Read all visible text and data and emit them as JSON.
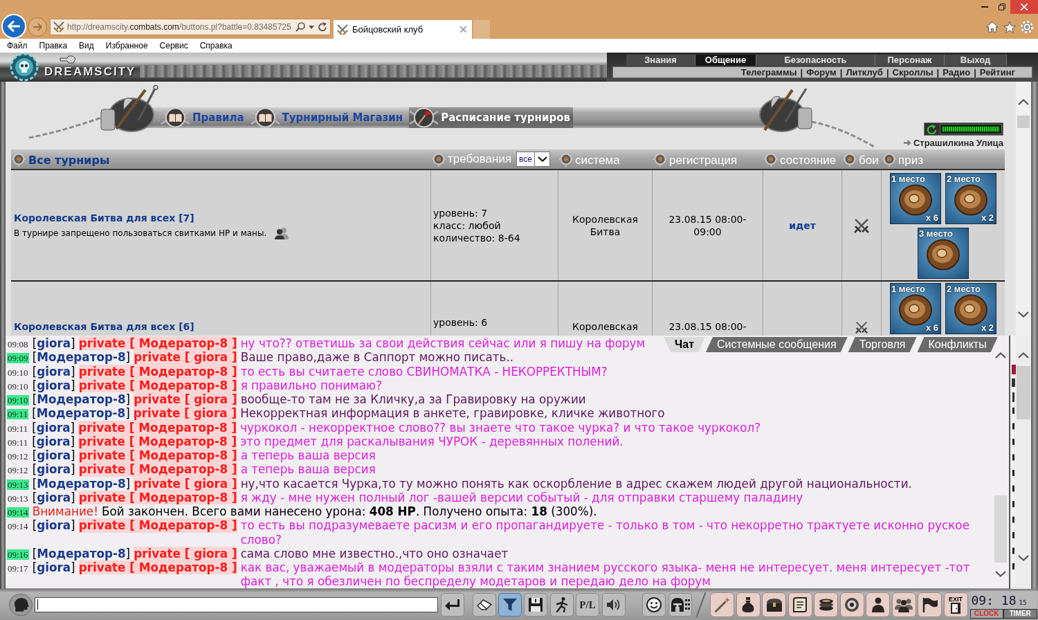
{
  "browser": {
    "address": {
      "start": "http://dreamscity.",
      "domain": "combats.com",
      "end": "/buttons.pl?battle=0.83485725"
    },
    "tabs": [
      {
        "title": "Бойцовский клуб",
        "selected": true
      }
    ],
    "menu": [
      "Файл",
      "Правка",
      "Вид",
      "Избранное",
      "Сервис",
      "Справка"
    ]
  },
  "game_header": {
    "logo": "DREAMSCITY",
    "nav": [
      {
        "label": "Знания",
        "selected": false
      },
      {
        "label": "Общение",
        "selected": true
      },
      {
        "label": "Безопасность",
        "selected": false
      },
      {
        "label": "Персонаж",
        "selected": false
      },
      {
        "label": "Выход",
        "selected": false
      }
    ],
    "subnav": [
      "Телеграммы",
      "Форум",
      "Литклуб",
      "Скроллы",
      "Радио",
      "Рейтинг"
    ],
    "subnav_separator": "|"
  },
  "tournaments": {
    "tabs": [
      {
        "label": "Правила",
        "selected": false
      },
      {
        "label": "Турнирный Магазин",
        "selected": false
      },
      {
        "label": "Расписание турниров",
        "selected": true
      }
    ],
    "refresh_timer": {
      "level": 1
    },
    "location": "Страшилкина Улица",
    "columns": [
      {
        "kind": "link",
        "label": "Все турниры"
      },
      {
        "kind": "filter",
        "label": "требования",
        "filter": "все"
      },
      {
        "kind": "label",
        "label": "система"
      },
      {
        "kind": "label",
        "label": "регистрация"
      },
      {
        "kind": "label",
        "label": "состояние"
      },
      {
        "kind": "label",
        "label": "бои"
      },
      {
        "kind": "label",
        "label": "приз"
      }
    ],
    "rows": [
      {
        "title": "Королевская Битва для всех [7]",
        "note": "В турнире запрещено пользоваться свитками HP и маны.",
        "note_icon": true,
        "requirements": [
          "уровень: 7",
          "класс: любой",
          "количество: 8-64"
        ],
        "system": "Королевская Битва",
        "registration": [
          "23.08.15 08:00-",
          "09:00"
        ],
        "status": "идет",
        "fights": true,
        "prizes": [
          {
            "place": "1 место",
            "count": "x 6"
          },
          {
            "place": "2 место",
            "count": "x 2"
          },
          {
            "place": "3 место"
          }
        ]
      },
      {
        "title": "Королевская Битва для всех [6]",
        "requirements": [
          "уровень: 6"
        ],
        "system": "Королевская",
        "registration": [
          "23.08.15 08:00-"
        ],
        "fights": true,
        "prizes": [
          {
            "place": "1 место",
            "count": "x 6"
          },
          {
            "place": "2 место",
            "count": "x 2"
          }
        ]
      }
    ]
  },
  "chat": {
    "tabs": [
      {
        "label": "Чат",
        "selected": true
      },
      {
        "label": "Системные сообщения",
        "selected": false
      },
      {
        "label": "Торговля",
        "selected": false
      },
      {
        "label": "Конфликты",
        "selected": false
      }
    ],
    "lines": [
      {
        "kind": "private",
        "time": "09:08",
        "highlighted": false,
        "sender": "[**giora**]",
        "private": "private [ Модератор-8 ]",
        "text": "ну что?? ответишь за свои действия сейчас или я пишу на форум",
        "color": "#e01ee0"
      },
      {
        "kind": "private",
        "time": "09:09",
        "highlighted": true,
        "sender": "[**Модератор-8**]",
        "private": "private [ giora ]",
        "text": "Ваше право,даже в Саппорт можно писать..",
        "color": "#5e1760"
      },
      {
        "kind": "private",
        "time": "09:10",
        "highlighted": false,
        "sender": "[**giora**]",
        "private": "private [ Модератор-8 ]",
        "text": "то есть вы считаете слово СВИНОМАТКА - НЕКОРРЕКТНЫМ?",
        "color": "#e01ee0"
      },
      {
        "kind": "private",
        "time": "09:10",
        "highlighted": false,
        "sender": "[**giora**]",
        "private": "private [ Модератор-8 ]",
        "text": "я правильно понимаю?",
        "color": "#e01ee0"
      },
      {
        "kind": "private",
        "time": "09:10",
        "highlighted": true,
        "sender": "[**Модератор-8**]",
        "private": "private [ giora ]",
        "text": "вообще-то там не за Кличку,а за Гравировку на оружии",
        "color": "#5e1760"
      },
      {
        "kind": "private",
        "time": "09:11",
        "highlighted": true,
        "sender": "[**Модератор-8**]",
        "private": "private [ giora ]",
        "text": "Некорректная информация в анкете, гравировке, кличке животного",
        "color": "#5e1760"
      },
      {
        "kind": "private",
        "time": "09:11",
        "highlighted": false,
        "sender": "[**giora**]",
        "private": "private [ Модератор-8 ]",
        "text": "чуркокол - некорректное слово?? вы знаете что такое чурка? и что такое чуркокол?",
        "color": "#e01ee0"
      },
      {
        "kind": "private",
        "time": "09:11",
        "highlighted": false,
        "sender": "[**giora**]",
        "private": "private [ Модератор-8 ]",
        "text": "это предмет для раскалывания ЧУРОК - деревянных полений.",
        "color": "#e01ee0"
      },
      {
        "kind": "private",
        "time": "09:12",
        "highlighted": false,
        "sender": "[**giora**]",
        "private": "private [ Модератор-8 ]",
        "text": "а теперь ваша версия",
        "color": "#e01ee0"
      },
      {
        "kind": "private",
        "time": "09:12",
        "highlighted": false,
        "sender": "[**giora**]",
        "private": "private [ Модератор-8 ]",
        "text": "а теперь ваша версия",
        "color": "#e01ee0"
      },
      {
        "kind": "private",
        "time": "09:13",
        "highlighted": true,
        "sender": "[**Модератор-8**]",
        "private": "private [ giora ]",
        "text": "ну,что касается Чурка,то ту можно понять как оскорбление в адрес скажем людей другой национальности.",
        "color": "#5e1760"
      },
      {
        "kind": "private",
        "time": "09:13",
        "highlighted": false,
        "sender": "[**giora**]",
        "private": "private [ Модератор-8 ]",
        "text": "я жду - мне нужен полный лог -вашей версии событый - для отправки старшему паладину",
        "color": "#e01ee0"
      },
      {
        "kind": "system",
        "time": "09:14",
        "highlighted": true,
        "alert": "Внимание!",
        "text": "Бой закончен. Всего вами нанесено урона: **408 HP**. Получено опыта: **18** (300%).",
        "color": "#000000"
      },
      {
        "kind": "private",
        "time": "09:14",
        "highlighted": false,
        "sender": "[**giora**]",
        "private": "private [ Модератор-8 ]",
        "text": "то есть вы подразумеваете расизм и его пропагандируете - только в том - что некорретно трактуете исконно руское слово?",
        "color": "#e01ee0"
      },
      {
        "kind": "private",
        "time": "09:16",
        "highlighted": true,
        "sender": "[**Модератор-8**]",
        "private": "private [ giora ]",
        "text": "сама слово мне известно.,что оно означает",
        "color": "#5e1760"
      },
      {
        "kind": "private",
        "time": "09:17",
        "highlighted": false,
        "sender": "[**giora**]",
        "private": "private [ Модератор-8 ]",
        "text": "как вас, уважаемый в модераторы взяли с таким знанием русского языка- меня не интересует. меня интересует -тот факт , что я обезличен по беспределу модетаров и передаю дело на форум",
        "color": "#e01ee0"
      }
    ]
  },
  "toolbar": {
    "chat_tools": [
      {
        "kind": "icon",
        "active": false
      },
      {
        "kind": "icon",
        "active": false
      },
      {
        "kind": "icon",
        "active": true
      },
      {
        "kind": "icon",
        "active": false
      },
      {
        "kind": "icon",
        "active": false
      },
      {
        "kind": "label",
        "label": "P/L",
        "active": false
      },
      {
        "kind": "icon",
        "active": false
      },
      {
        "kind": "icon",
        "active": false
      },
      {
        "kind": "icon",
        "active": false
      }
    ],
    "game_tools": [
      {
        "kind": "icon"
      },
      {
        "kind": "icon"
      },
      {
        "kind": "icon"
      },
      {
        "kind": "icon"
      },
      {
        "kind": "icon"
      },
      {
        "kind": "icon"
      },
      {
        "kind": "icon"
      },
      {
        "kind": "icon"
      },
      {
        "kind": "icon"
      },
      {
        "kind": "labeled",
        "label": "EXIT"
      }
    ],
    "clock": {
      "time": "09: 18",
      "seconds": "15",
      "modes": [
        {
          "label": "CLOCK",
          "selected": true
        },
        {
          "label": "TIMER",
          "selected": false
        }
      ]
    }
  }
}
